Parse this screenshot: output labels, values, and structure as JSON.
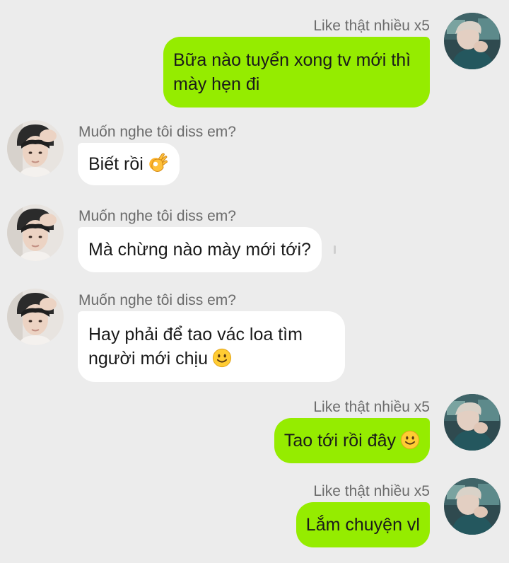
{
  "conversation": {
    "me": {
      "name": "Like thật nhiều x5"
    },
    "friend": {
      "name": "Muốn nghe tôi diss em?"
    },
    "messages": [
      {
        "from": "me",
        "lines": [
          "Bữa nào tuyển xong tv mới thì",
          "mày hẹn đi"
        ],
        "emoji": null
      },
      {
        "from": "friend",
        "lines": [
          "Biết rồi"
        ],
        "emoji": "ok-hand-emoji"
      },
      {
        "from": "friend",
        "lines": [
          "Mà chừng nào mày mới tới?"
        ],
        "emoji": null
      },
      {
        "from": "friend",
        "lines": [
          "Hay phải để tao vác loa tìm",
          "người mới chịu"
        ],
        "emoji": "slightly-smiling-face-emoji"
      },
      {
        "from": "me",
        "lines": [
          "Tao tới rồi đây"
        ],
        "emoji": "slightly-smiling-face-emoji"
      },
      {
        "from": "me",
        "lines": [
          "Lắm chuyện vl"
        ],
        "emoji": null
      }
    ]
  },
  "colors": {
    "background": "#ececec",
    "outgoing_bubble": "#95ec00",
    "incoming_bubble": "#ffffff",
    "sender_name": "#6b6b6b"
  }
}
